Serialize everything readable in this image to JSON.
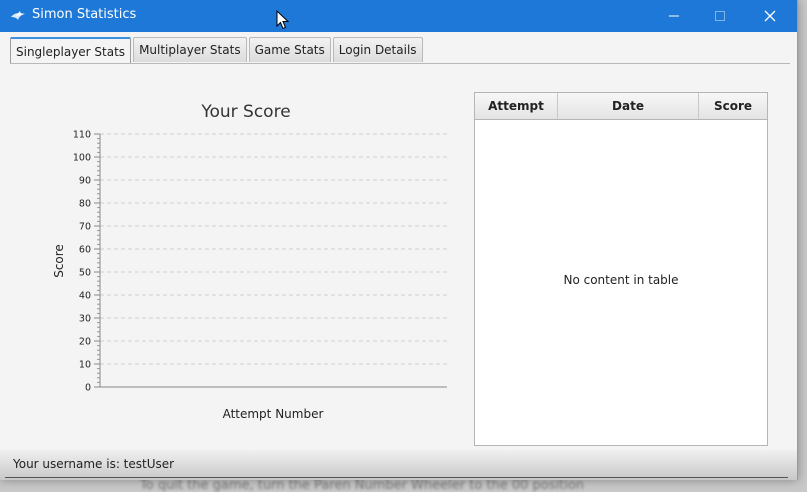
{
  "window": {
    "title": "Simon Statistics",
    "accent": "#1e78d8"
  },
  "tabs": [
    {
      "label": "Singleplayer Stats",
      "active": true
    },
    {
      "label": "Multiplayer Stats",
      "active": false
    },
    {
      "label": "Game Stats",
      "active": false
    },
    {
      "label": "Login Details",
      "active": false
    }
  ],
  "chart_data": {
    "type": "line",
    "title": "Your Score",
    "xlabel": "Attempt Number",
    "ylabel": "Score",
    "ylim": [
      0,
      110
    ],
    "yticks": [
      0,
      10,
      20,
      30,
      40,
      50,
      60,
      70,
      80,
      90,
      100,
      110
    ],
    "grid": true,
    "series": []
  },
  "table": {
    "columns": [
      "Attempt",
      "Date",
      "Score"
    ],
    "rows": [],
    "empty_message": "No content in table"
  },
  "status": {
    "text": "Your username is: testUser"
  },
  "background_text": "To quit the game, turn the Paren Number Wheeler to the 00 position"
}
